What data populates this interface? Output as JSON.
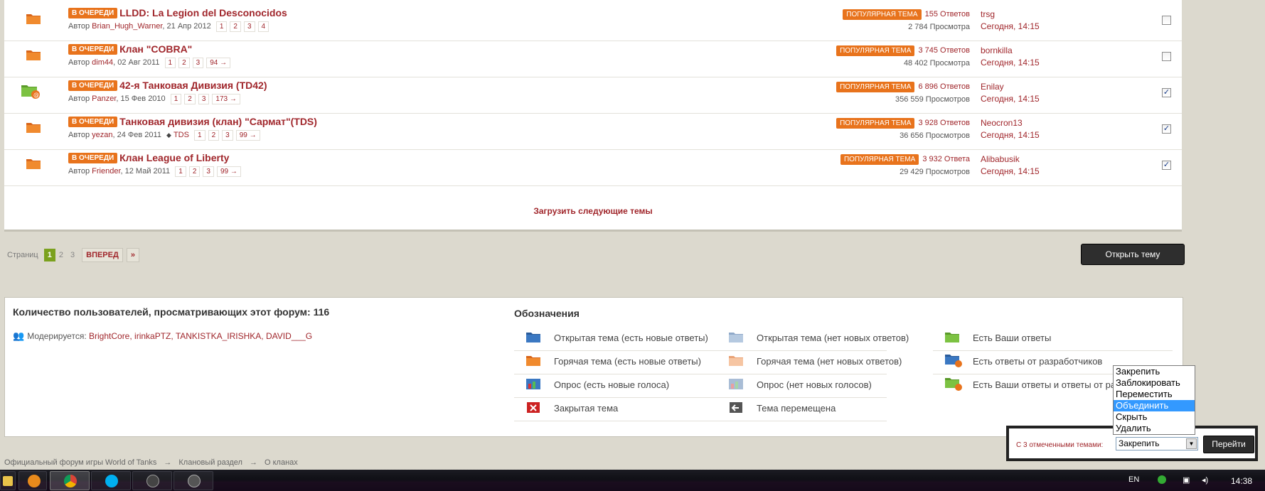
{
  "topics": [
    {
      "badge": "В ОЧЕРЕДИ",
      "title": "LLDD: La Legion del Desconocidos",
      "author_prefix": "Автор",
      "author": "Brian_Hugh_Warner",
      "date": ", 21 Апр 2012",
      "pages": [
        "1",
        "2",
        "3",
        "4"
      ],
      "tag": "",
      "hot": "ПОПУЛЯРНАЯ ТЕМА",
      "replies": "155 Ответов",
      "views": "2 784 Просмотра",
      "last_user": "trsg",
      "last_time": "Сегодня, 14:15",
      "checked": false,
      "icon": "folder-hot-icon"
    },
    {
      "badge": "В ОЧЕРЕДИ",
      "title": "Клан \"COBRA\"",
      "author_prefix": "Автор",
      "author": "dim44",
      "date": ", 02 Авг 2011",
      "pages": [
        "1",
        "2",
        "3",
        "94 →"
      ],
      "tag": "",
      "hot": "ПОПУЛЯРНАЯ ТЕМА",
      "replies": "3 745 Ответов",
      "views": "48 402 Просмотра",
      "last_user": "bornkilla",
      "last_time": "Сегодня, 14:15",
      "checked": false,
      "icon": "folder-hot-icon"
    },
    {
      "badge": "В ОЧЕРЕДИ",
      "title": "42-я Танковая Дивизия (TD42)",
      "author_prefix": "Автор",
      "author": "Panzer",
      "date": ", 15 Фев 2010",
      "pages": [
        "1",
        "2",
        "3",
        "173 →"
      ],
      "tag": "",
      "hot": "ПОПУЛЯРНАЯ ТЕМА",
      "replies": "6 896 Ответов",
      "views": "356 559 Просмотров",
      "last_user": "Enilay",
      "last_time": "Сегодня, 14:15",
      "checked": true,
      "icon": "folder-dev-reply-icon"
    },
    {
      "badge": "В ОЧЕРЕДИ",
      "title": "Танковая дивизия (клан) \"Сармат\"(TDS)",
      "author_prefix": "Автор",
      "author": "yezan",
      "date": ", 24 Фев 2011",
      "pages": [
        "1",
        "2",
        "3",
        "99 →"
      ],
      "tag": "TDS",
      "hot": "ПОПУЛЯРНАЯ ТЕМА",
      "replies": "3 928 Ответов",
      "views": "36 656 Просмотров",
      "last_user": "Neocron13",
      "last_time": "Сегодня, 14:15",
      "checked": true,
      "icon": "folder-hot-icon"
    },
    {
      "badge": "В ОЧЕРЕДИ",
      "title": "Клан League of Liberty",
      "author_prefix": "Автор",
      "author": "Friender",
      "date": ", 12 Май 2011",
      "pages": [
        "1",
        "2",
        "3",
        "99 →"
      ],
      "tag": "",
      "hot": "ПОПУЛЯРНАЯ ТЕМА",
      "replies": "3 932 Ответа",
      "views": "29 429 Просмотров",
      "last_user": "Alibabusik",
      "last_time": "Сегодня, 14:15",
      "checked": true,
      "icon": "folder-hot-icon"
    }
  ],
  "load_more": "Загрузить следующие темы",
  "pagination": {
    "label": "Страниц",
    "current": "1",
    "pages": [
      "2",
      "3"
    ],
    "next": "ВПЕРЕД",
    "last": "»"
  },
  "open_topic": "Открыть тему",
  "stats": {
    "online_title": "Количество пользователей, просматривающих этот форум: 116",
    "moderated_label": "Модерируется:",
    "moderators": "BrightCore, irinkaPTZ, TANKISTKA_IRISHKA, DAVID___G"
  },
  "legend": {
    "title": "Обозначения",
    "items": [
      {
        "label": "Открытая тема (есть новые ответы)",
        "icon": "folder-blue-icon"
      },
      {
        "label": "Открытая тема (нет новых ответов)",
        "icon": "folder-lightblue-icon"
      },
      {
        "label": "Есть Ваши ответы",
        "icon": "folder-green-icon"
      },
      {
        "label": "Горячая тема (есть новые ответы)",
        "icon": "folder-orange-icon"
      },
      {
        "label": "Горячая тема (нет новых ответов)",
        "icon": "folder-peach-icon"
      },
      {
        "label": "Есть ответы от разработчиков",
        "icon": "folder-dev-icon"
      },
      {
        "label": "Опрос (есть новые голоса)",
        "icon": "poll-icon"
      },
      {
        "label": "Опрос (нет новых голосов)",
        "icon": "poll-light-icon"
      },
      {
        "label": "Есть Ваши ответы и ответы от раз",
        "icon": "folder-green-dev-icon"
      },
      {
        "label": "Закрытая тема",
        "icon": "closed-icon"
      },
      {
        "label": "Тема перемещена",
        "icon": "moved-icon"
      }
    ]
  },
  "breadcrumb": [
    "Официальный форум игры World of Tanks",
    "Клановый раздел",
    "О кланах"
  ],
  "moderation": {
    "label": "С 3 отмеченными темами:",
    "selected": "Закрепить",
    "options": [
      "Закрепить",
      "Заблокировать",
      "Переместить",
      "Объединить",
      "Скрыть",
      "Удалить"
    ],
    "highlighted": "Объединить",
    "go": "Перейти"
  },
  "taskbar": {
    "lang": "EN",
    "clock": "14:38"
  },
  "colors": {
    "accent": "#a0262b",
    "badge": "#e8731c",
    "page_current": "#7ba11e"
  }
}
